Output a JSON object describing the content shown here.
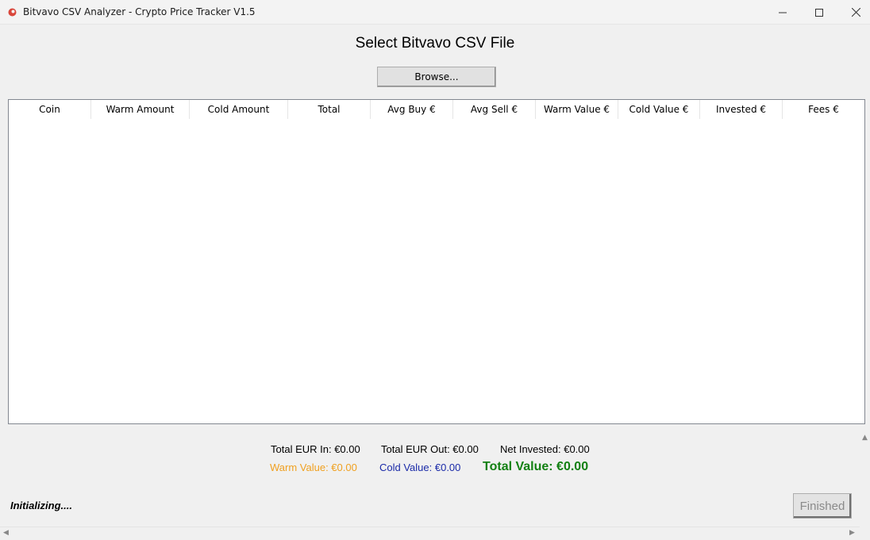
{
  "window": {
    "title": "Bitvavo CSV Analyzer - Crypto Price Tracker V1.5"
  },
  "heading": "Select Bitvavo CSV File",
  "browse_label": "Browse...",
  "table": {
    "columns": [
      "Coin",
      "Warm Amount",
      "Cold Amount",
      "Total",
      "Avg Buy €",
      "Avg Sell €",
      "Warm Value €",
      "Cold Value €",
      "Invested €",
      "Fees €"
    ],
    "rows": []
  },
  "summary": {
    "total_eur_in": "Total EUR In: €0.00",
    "total_eur_out": "Total EUR Out: €0.00",
    "net_invested": "Net Invested: €0.00",
    "warm_value": "Warm Value: €0.00",
    "cold_value": "Cold Value: €0.00",
    "total_value": "Total Value: €0.00"
  },
  "status_text": "Initializing....",
  "finished_label": "Finished",
  "colors": {
    "warm": "#f0a020",
    "cold": "#1a2aa8",
    "total": "#128012",
    "app_icon": "#d9463b"
  },
  "icons": [
    "app-icon",
    "minimize-icon",
    "maximize-icon",
    "close-icon",
    "scroll-up-arrow-icon",
    "scroll-left-arrow-icon",
    "scroll-right-arrow-icon"
  ]
}
